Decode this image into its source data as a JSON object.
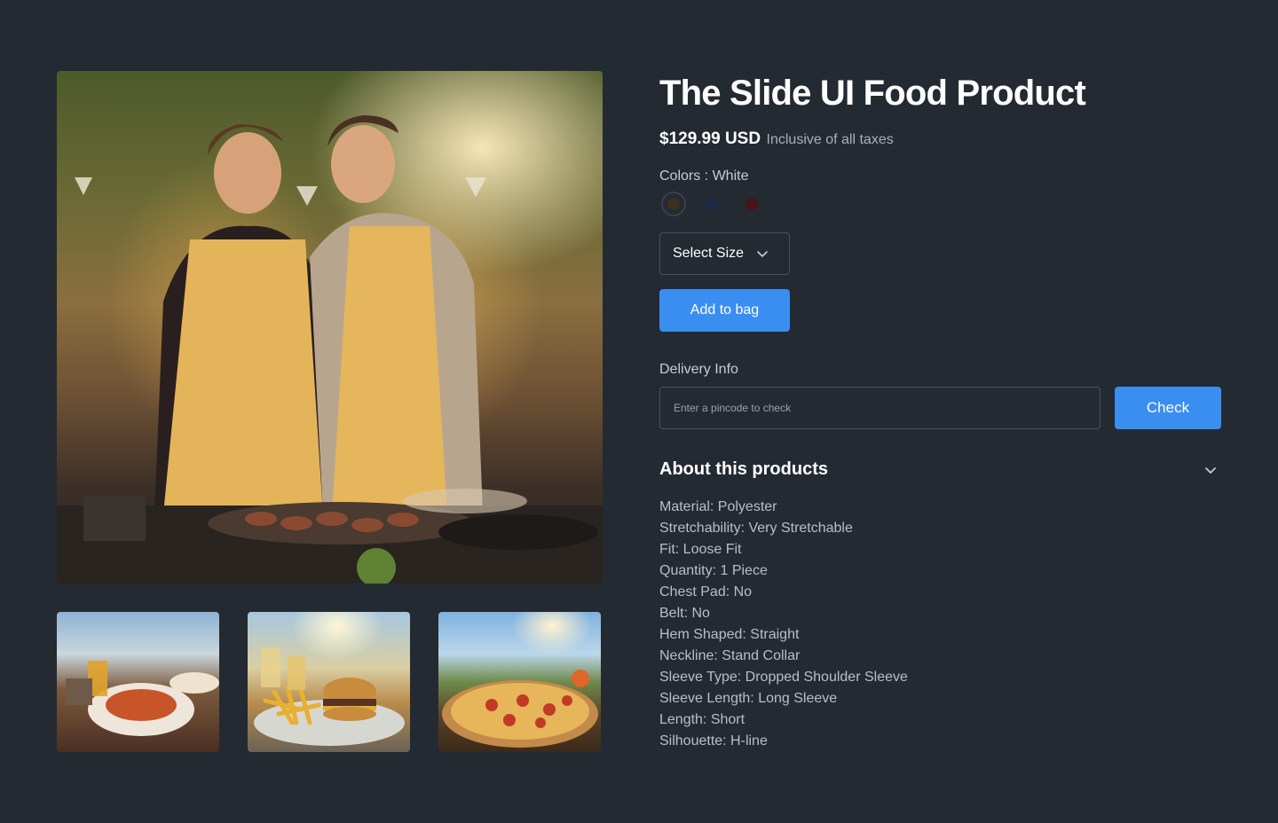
{
  "product": {
    "title": "The Slide UI Food Product",
    "price": "$129.99 USD",
    "tax_note": "Inclusive of all taxes",
    "colors_label": "Colors : White",
    "colors": [
      "#3b2f1f",
      "#1b2a45",
      "#4a1517"
    ],
    "size_select_label": "Select Size",
    "add_to_bag_label": "Add to bag"
  },
  "delivery": {
    "label": "Delivery Info",
    "placeholder": "Enter a pincode to check",
    "check_label": "Check"
  },
  "about": {
    "title": "About this products",
    "specs": [
      "Material: Polyester",
      "Stretchability: Very Stretchable",
      "Fit: Loose Fit",
      "Quantity: 1 Piece",
      "Chest Pad: No",
      "Belt: No",
      "Hem Shaped: Straight",
      "Neckline: Stand Collar",
      "Sleeve Type: Dropped Shoulder Sleeve",
      "Sleeve Length: Long Sleeve",
      "Length: Short",
      "Silhouette: H-line"
    ]
  },
  "gallery": {
    "main_image": "couple-cooking-outdoor-photo",
    "thumbnails": [
      "food-table-photo",
      "burger-fries-photo",
      "pizza-photo"
    ]
  }
}
